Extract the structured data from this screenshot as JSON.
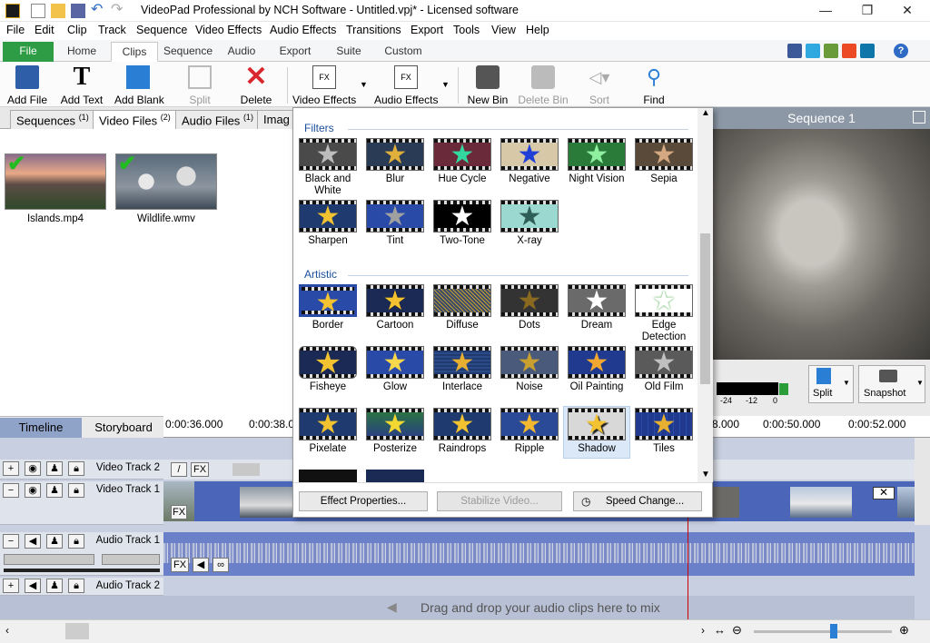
{
  "window": {
    "title": "VideoPad Professional by NCH Software - Untitled.vpj* - Licensed software"
  },
  "menu": [
    "File",
    "Edit",
    "Clip",
    "Track",
    "Sequence",
    "Video Effects",
    "Audio Effects",
    "Transitions",
    "Export",
    "Tools",
    "View",
    "Help"
  ],
  "ribbon_tabs": [
    "File",
    "Home",
    "Clips",
    "Sequence",
    "Audio",
    "Export",
    "Suite",
    "Custom"
  ],
  "ribbon_active": "Clips",
  "toolbar": {
    "add_file": "Add File",
    "add_text": "Add Text",
    "add_blank": "Add Blank",
    "split": "Split",
    "delete": "Delete",
    "video_effects": "Video Effects",
    "audio_effects": "Audio Effects",
    "new_bin": "New Bin",
    "delete_bin": "Delete Bin",
    "sort": "Sort",
    "find": "Find"
  },
  "bin_tabs": [
    {
      "label": "Sequences",
      "count": "(1)"
    },
    {
      "label": "Video Files",
      "count": "(2)"
    },
    {
      "label": "Audio Files",
      "count": "(1)"
    },
    {
      "label": "Imag",
      "count": ""
    }
  ],
  "clips": [
    {
      "name": "Islands.mp4"
    },
    {
      "name": "Wildlife.wmv"
    }
  ],
  "effects_popup": {
    "filters_heading": "Filters",
    "filters": [
      "Black and White",
      "Blur",
      "Hue Cycle",
      "Negative",
      "Night Vision",
      "Sepia",
      "Sharpen",
      "Tint",
      "Two-Tone",
      "X-ray"
    ],
    "artistic_heading": "Artistic",
    "artistic": [
      "Border",
      "Cartoon",
      "Diffuse",
      "Dots",
      "Dream",
      "Edge Detection",
      "Fisheye",
      "Glow",
      "Interlace",
      "Noise",
      "Oil Painting",
      "Old Film",
      "Pixelate",
      "Posterize",
      "Raindrops",
      "Ripple",
      "Shadow",
      "Tiles"
    ],
    "selected": "Shadow",
    "buttons": {
      "effect_properties": "Effect Properties...",
      "stabilize": "Stabilize Video...",
      "speed_change": "Speed Change..."
    }
  },
  "preview": {
    "sequence_title": "Sequence 1",
    "meter_labels": [
      "-24",
      "-12",
      "0"
    ],
    "split": "Split",
    "snapshot": "Snapshot"
  },
  "timeline": {
    "tabs": [
      "Timeline",
      "Storyboard"
    ],
    "ruler": [
      "0:00:36.000",
      "0:00:38.0",
      "8.000",
      "0:00:50.000",
      "0:00:52.000"
    ],
    "tracks": {
      "video2": "Video Track 2",
      "video1": "Video Track 1",
      "audio1": "Audio Track 1",
      "audio2": "Audio Track 2"
    },
    "fx": "FX",
    "drop_hint": "Drag and drop your audio clips here to mix"
  },
  "colors": {
    "accent": "#2e9c45",
    "timeline_bg": "#c7cfe0",
    "video_track": "#4b66b8",
    "audio_track": "#6a80c8",
    "playhead": "#cc0000"
  }
}
